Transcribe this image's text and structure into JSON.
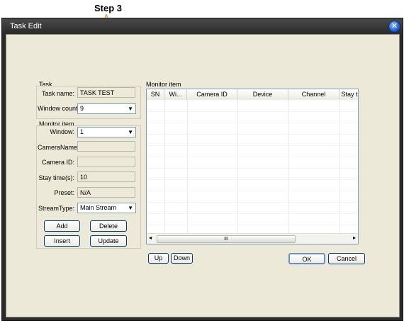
{
  "annotation": {
    "label": "Step 3"
  },
  "window": {
    "title": "Task Edit",
    "close_glyph": "✕"
  },
  "task_group": {
    "title": "Task",
    "task_name_label": "Task name:",
    "task_name_value": "TASK TEST",
    "window_count_label": "Window count:",
    "window_count_value": "9"
  },
  "monitor_group": {
    "title": "Monitor item",
    "window_label": "Window:",
    "window_value": "1",
    "camera_name_label": "CameraName:",
    "camera_name_value": "",
    "camera_id_label": "Camera ID:",
    "camera_id_value": "",
    "stay_time_label": "Stay time(s):",
    "stay_time_value": "10",
    "preset_label": "Preset:",
    "preset_value": "N/A",
    "stream_type_label": "StreamType:",
    "stream_type_value": "Main Stream",
    "add_label": "Add",
    "delete_label": "Delete",
    "insert_label": "Insert",
    "update_label": "Update"
  },
  "monitor_table": {
    "title": "Monitor item",
    "columns": [
      "SN",
      "Wi...",
      "Camera ID",
      "Device",
      "Channel",
      "Stay t"
    ],
    "scroll_thumb": "III"
  },
  "footer": {
    "up_label": "Up",
    "down_label": "Down",
    "ok_label": "OK",
    "cancel_label": "Cancel"
  },
  "colors": {
    "annotation_arrow": "#f0a040",
    "dialog_bg": "#ece9d8",
    "titlebar": "#2f2f2f"
  },
  "icons": {
    "dropdown": "dropdown-arrow-icon",
    "close": "close-icon"
  }
}
